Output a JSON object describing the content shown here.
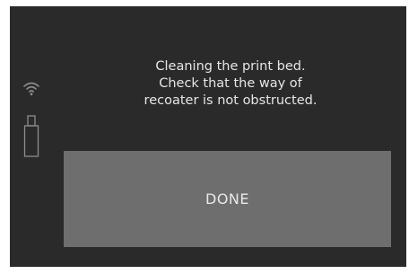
{
  "status_bar": {
    "wifi_icon": "wifi-icon",
    "usb_icon": "usb-drive-icon"
  },
  "message": {
    "lines": [
      "Cleaning the print bed.",
      "Check that the way of",
      "recoater is not obstructed."
    ]
  },
  "done_button": {
    "label": "DONE"
  },
  "colors": {
    "screen_background": "#2a2a2a",
    "button_background": "#6e6e6e",
    "text": "#e6e6e6",
    "icon": "#8c8c8c"
  }
}
